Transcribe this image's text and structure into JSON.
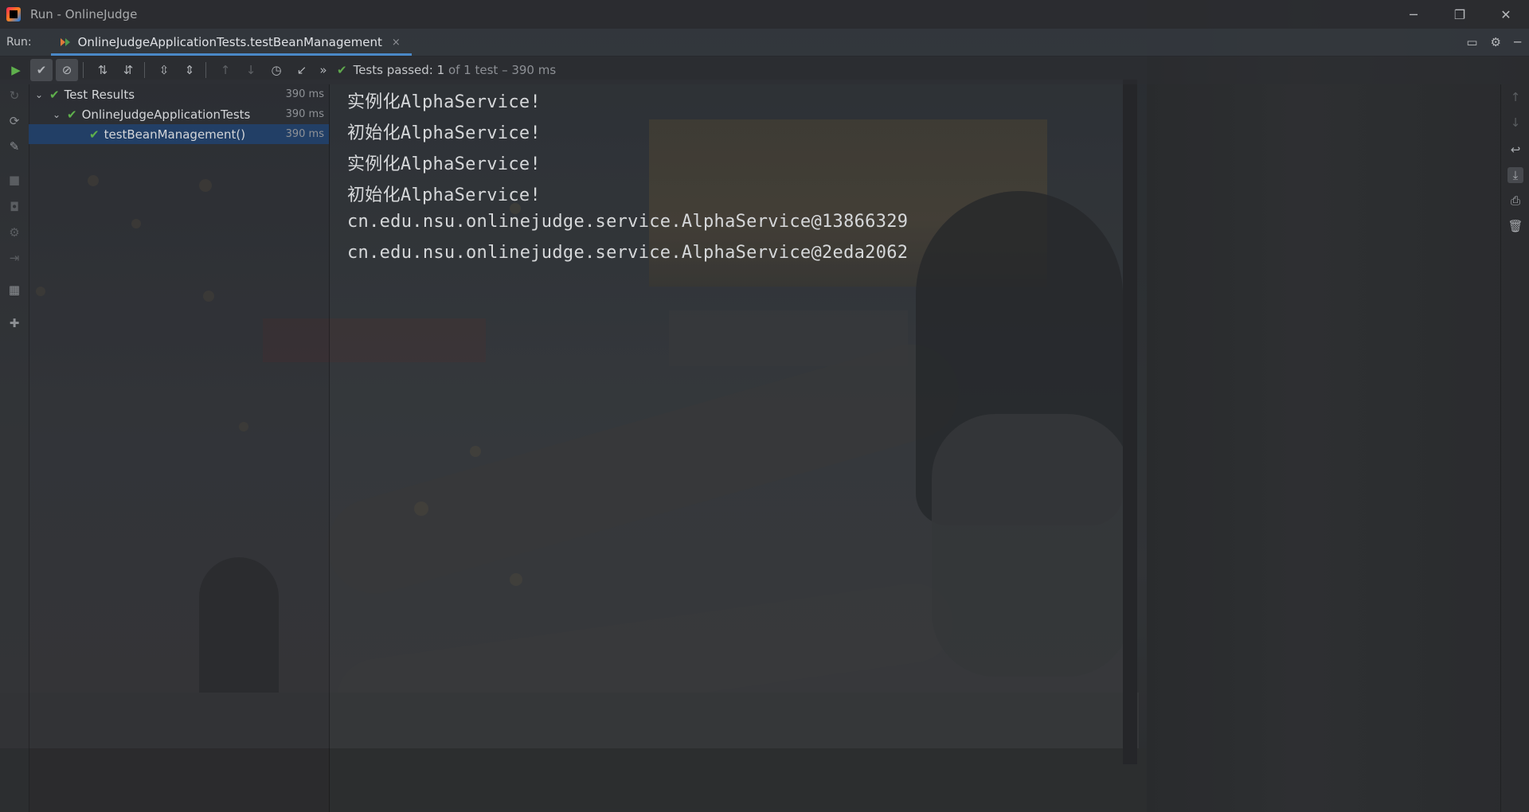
{
  "window": {
    "title": "Run - OnlineJudge",
    "buttons": {
      "minimize": "─",
      "restore": "❐",
      "close": "✕"
    }
  },
  "runbar": {
    "label": "Run:",
    "tab_label": "OnlineJudgeApplicationTests.testBeanManagement",
    "tab_close": "×",
    "right_icons": [
      "layout-icon",
      "gear-icon",
      "hide-icon"
    ]
  },
  "toolbar": {
    "more": "»",
    "status_passed": "Tests passed: 1",
    "status_detail": "of 1 test – 390 ms"
  },
  "tree": {
    "rows": [
      {
        "label": "Test Results",
        "duration": "390 ms"
      },
      {
        "label": "OnlineJudgeApplicationTests",
        "duration": "390 ms"
      },
      {
        "label": "testBeanManagement()",
        "duration": "390 ms"
      }
    ]
  },
  "console": {
    "lines": [
      "实例化AlphaService!",
      "初始化AlphaService!",
      "实例化AlphaService!",
      "初始化AlphaService!",
      "cn.edu.nsu.onlinejudge.service.AlphaService@13866329",
      "cn.edu.nsu.onlinejudge.service.AlphaService@2eda2062"
    ]
  },
  "colors": {
    "accent": "#4a88c7",
    "pass": "#5fb04c",
    "selection": "#214270"
  }
}
